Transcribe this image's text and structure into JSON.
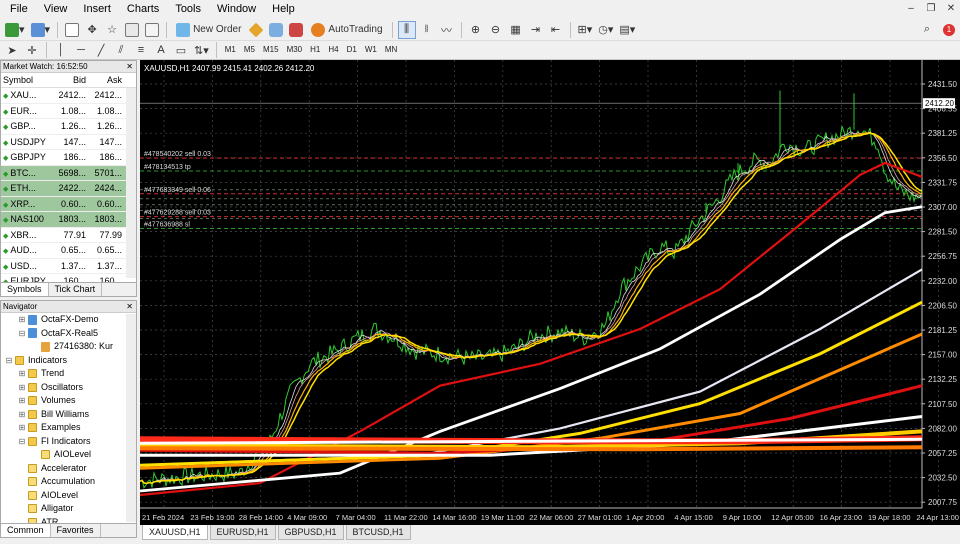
{
  "menu": {
    "items": [
      "File",
      "View",
      "Insert",
      "Charts",
      "Tools",
      "Window",
      "Help"
    ]
  },
  "toolbar": {
    "new_order": "New Order",
    "autotrading": "AutoTrading"
  },
  "timeframes": [
    "M1",
    "M5",
    "M15",
    "M30",
    "H1",
    "H4",
    "D1",
    "W1",
    "MN"
  ],
  "market_watch": {
    "title": "Market Watch: 16:52:50",
    "headers": {
      "symbol": "Symbol",
      "bid": "Bid",
      "ask": "Ask"
    },
    "rows": [
      {
        "symbol": "XAU...",
        "bid": "2412...",
        "ask": "2412...",
        "highlight": false
      },
      {
        "symbol": "EUR...",
        "bid": "1.08...",
        "ask": "1.08...",
        "highlight": false
      },
      {
        "symbol": "GBP...",
        "bid": "1.26...",
        "ask": "1.26...",
        "highlight": false
      },
      {
        "symbol": "USDJPY",
        "bid": "147...",
        "ask": "147...",
        "highlight": false
      },
      {
        "symbol": "GBPJPY",
        "bid": "186...",
        "ask": "186...",
        "highlight": false
      },
      {
        "symbol": "BTC...",
        "bid": "5698...",
        "ask": "5701...",
        "highlight": true
      },
      {
        "symbol": "ETH...",
        "bid": "2422...",
        "ask": "2424...",
        "highlight": true
      },
      {
        "symbol": "XRP...",
        "bid": "0.60...",
        "ask": "0.60...",
        "highlight": true
      },
      {
        "symbol": "NAS100",
        "bid": "1803...",
        "ask": "1803...",
        "highlight": true
      },
      {
        "symbol": "XBR...",
        "bid": "77.91",
        "ask": "77.99",
        "highlight": false
      },
      {
        "symbol": "AUD...",
        "bid": "0.65...",
        "ask": "0.65...",
        "highlight": false
      },
      {
        "symbol": "USD...",
        "bid": "1.37...",
        "ask": "1.37...",
        "highlight": false
      },
      {
        "symbol": "EURJPY",
        "bid": "160...",
        "ask": "160...",
        "highlight": false
      }
    ],
    "tabs": [
      "Symbols",
      "Tick Chart"
    ]
  },
  "navigator": {
    "title": "Navigator",
    "items": [
      {
        "label": "OctaFX-Demo",
        "indent": 1,
        "kind": "account",
        "expander": "+"
      },
      {
        "label": "OctaFX-Real5",
        "indent": 1,
        "kind": "account",
        "expander": "-"
      },
      {
        "label": "27416380: Kur",
        "indent": 2,
        "kind": "user",
        "expander": ""
      },
      {
        "label": "Indicators",
        "indent": 0,
        "kind": "folder",
        "expander": "-"
      },
      {
        "label": "Trend",
        "indent": 1,
        "kind": "folder",
        "expander": "+"
      },
      {
        "label": "Oscillators",
        "indent": 1,
        "kind": "folder",
        "expander": "+"
      },
      {
        "label": "Volumes",
        "indent": 1,
        "kind": "folder",
        "expander": "+"
      },
      {
        "label": "Bill Williams",
        "indent": 1,
        "kind": "folder",
        "expander": "+"
      },
      {
        "label": "Examples",
        "indent": 1,
        "kind": "folder",
        "expander": "+"
      },
      {
        "label": "FI Indicators",
        "indent": 1,
        "kind": "folder",
        "expander": "-"
      },
      {
        "label": "AIOLevel",
        "indent": 2,
        "kind": "indicator",
        "expander": ""
      },
      {
        "label": "Accelerator",
        "indent": 1,
        "kind": "indicator",
        "expander": ""
      },
      {
        "label": "Accumulation",
        "indent": 1,
        "kind": "indicator",
        "expander": ""
      },
      {
        "label": "AIOLevel",
        "indent": 1,
        "kind": "indicator",
        "expander": ""
      },
      {
        "label": "Alligator",
        "indent": 1,
        "kind": "indicator",
        "expander": ""
      },
      {
        "label": "ATR",
        "indent": 1,
        "kind": "indicator",
        "expander": ""
      }
    ],
    "tabs": [
      "Common",
      "Favorites"
    ]
  },
  "chart": {
    "header": "XAUUSD,H1  2407.99 2415.41 2402.26 2412.20",
    "current_price": "2412.20",
    "order_labels": [
      "#478540202 sell 0.03",
      "#478134513 tp",
      "#477683349 sell 0.06",
      "#477629288 sell 0.03",
      "#477636988 sl"
    ],
    "price_axis": [
      "2431.50",
      "2406.55",
      "2381.25",
      "2356.50",
      "2331.75",
      "2307.00",
      "2281.50",
      "2256.75",
      "2232.00",
      "2206.50",
      "2181.25",
      "2157.00",
      "2132.25",
      "2107.50",
      "2082.00",
      "2057.25",
      "2032.50",
      "2007.75"
    ],
    "time_axis": [
      "21 Feb 2024",
      "23 Feb 19:00",
      "28 Feb 14:00",
      "4 Mar 09:00",
      "7 Mar 04:00",
      "11 Mar 22:00",
      "14 Mar 16:00",
      "19 Mar 11:00",
      "22 Mar 06:00",
      "27 Mar 01:00",
      "1 Apr 20:00",
      "4 Apr 15:00",
      "9 Apr 10:00",
      "12 Apr 05:00",
      "16 Apr 23:00",
      "19 Apr 18:00",
      "24 Apr 13:00"
    ]
  },
  "chart_tabs": [
    {
      "label": "XAUUSD,H1",
      "active": true
    },
    {
      "label": "EURUSD,H1",
      "active": false
    },
    {
      "label": "GBPUSD,H1",
      "active": false
    },
    {
      "label": "BTCUSD,H1",
      "active": false
    }
  ],
  "colors": {
    "price_line": "#2ecc2e",
    "ma_red": "#e01010",
    "ma_white": "#ffffff",
    "ma_yellow": "#ffe000",
    "ma_orange": "#ff8c00"
  }
}
